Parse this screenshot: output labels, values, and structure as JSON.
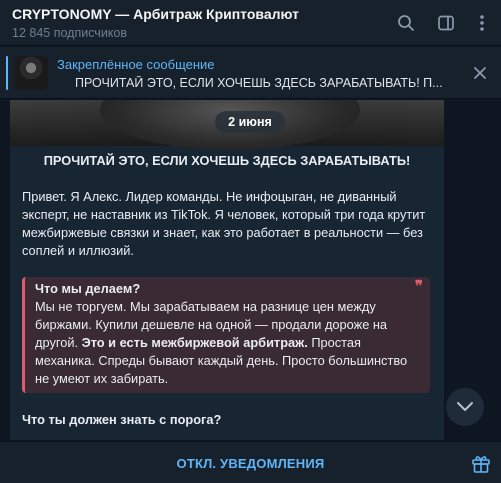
{
  "header": {
    "title": "CRYPTONOMY — Арбитраж Криптовалют",
    "subscribers": "12 845 подписчиков",
    "icons": [
      "search-icon",
      "sidebar-toggle-icon",
      "more-menu-icon"
    ]
  },
  "pinned": {
    "label": "Закреплённое сообщение",
    "text": "ПРОЧИТАЙ ЭТО, ЕСЛИ ХОЧЕШЬ ЗДЕСЬ ЗАРАБАТЫВАТЬ! П..."
  },
  "chat": {
    "date": "2 июня",
    "message": {
      "heading": "ПРОЧИТАЙ ЭТО, ЕСЛИ ХОЧЕШЬ ЗДЕСЬ ЗАРАБАТЫВАТЬ!",
      "intro": "Привет. Я Алекс. Лидер команды. Не инфоцыган, не диванный эксперт, не наставник из TikTok. Я человек, который три года крутит межбиржевые связки и знает, как это работает в реальности — без соплей и иллюзий.",
      "quote": {
        "title": "Что мы делаем?",
        "text_before": "Мы не торгуем. Мы зарабатываем на разнице цен между биржами. Купили дешевле на одной — продали дороже на другой.",
        "bold": "Это и есть межбиржевой арбитраж.",
        "text_after": "Простая механика. Спреды бывают каждый день. Просто большинство не умеют их забирать.",
        "mark": "❞"
      },
      "subheading": "Что ты должен знать с порога?"
    }
  },
  "bottom": {
    "mute_label": "ОТКЛ. УВЕДОМЛЕНИЯ"
  },
  "colors": {
    "accent": "#5eb5f7",
    "quote_accent": "#e05a6c",
    "background": "#0e1621",
    "panel": "#17212b",
    "bubble": "#182533"
  }
}
